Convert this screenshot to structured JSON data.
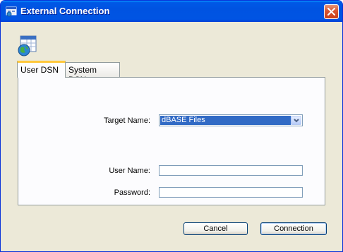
{
  "window": {
    "title": "External Connection"
  },
  "tabs": [
    {
      "label": "User DSN",
      "active": true
    },
    {
      "label": "System DSN",
      "active": false
    }
  ],
  "form": {
    "target_name_label": "Target Name:",
    "target_name_value": "dBASE Files",
    "user_name_label": "User Name:",
    "user_name_value": "",
    "password_label": "Password:",
    "password_value": ""
  },
  "buttons": {
    "cancel": "Cancel",
    "connection": "Connection"
  },
  "colors": {
    "titlebar": "#0054e3",
    "dialog_bg": "#ece9d8",
    "selection": "#316ac5",
    "tab_highlight": "#ffc83c"
  }
}
